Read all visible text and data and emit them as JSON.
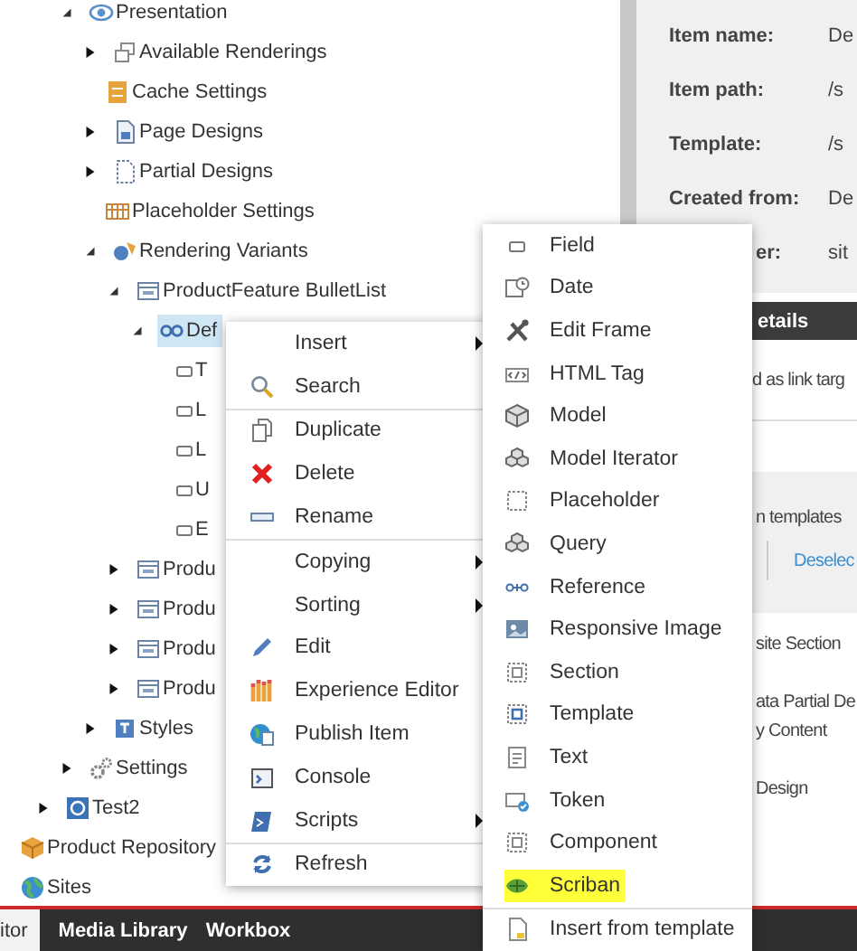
{
  "tree": {
    "items": [
      {
        "children": [
          {
            "children": [
              {
                "label": "Presentation",
                "expanded": true,
                "selected": false,
                "children": [
                  {
                    "label": "Available Renderings",
                    "expanded": false,
                    "selected": false
                  },
                  {
                    "label": "Cache Settings",
                    "selected": false
                  },
                  {
                    "label": "Page Designs",
                    "expanded": false,
                    "selected": false
                  },
                  {
                    "label": "Partial Designs",
                    "expanded": false,
                    "selected": false
                  },
                  {
                    "label": "Placeholder Settings",
                    "selected": false
                  },
                  {
                    "label": "Rendering Variants",
                    "expanded": true,
                    "selected": false,
                    "children": [
                      {
                        "label": "ProductFeature BulletList",
                        "expanded": true,
                        "selected": false,
                        "children": [
                          {
                            "label": "Def",
                            "expanded": true,
                            "selected": true,
                            "children": [
                              {
                                "label": "T",
                                "selected": false
                              },
                              {
                                "label": "L",
                                "selected": false
                              },
                              {
                                "label": "L",
                                "selected": false
                              },
                              {
                                "label": "U",
                                "selected": false
                              },
                              {
                                "label": "E",
                                "selected": false
                              }
                            ]
                          }
                        ]
                      },
                      {
                        "label": "Produ",
                        "expanded": false,
                        "selected": false
                      },
                      {
                        "label": "Produ",
                        "expanded": false,
                        "selected": false
                      },
                      {
                        "label": "Produ",
                        "expanded": false,
                        "selected": false
                      },
                      {
                        "label": "Produ",
                        "expanded": false,
                        "selected": false
                      }
                    ]
                  },
                  {
                    "label": "Styles",
                    "expanded": false,
                    "selected": false
                  }
                ]
              },
              {
                "label": "Settings",
                "expanded": false,
                "selected": false
              }
            ]
          },
          {
            "label": "Test2",
            "expanded": false,
            "selected": false
          }
        ]
      },
      {
        "label": "Product Repository",
        "selected": false
      },
      {
        "label": "Sites",
        "selected": false
      }
    ]
  },
  "details": {
    "fields": [
      {
        "label": "Item name:",
        "value": "De"
      },
      {
        "label": "Item path:",
        "value": "/s"
      },
      {
        "label": "Template:",
        "value": "/s"
      },
      {
        "label": "Created from:",
        "value": "De"
      },
      {
        "label": "er:",
        "value": "sit",
        "cut": true
      }
    ],
    "section_title": "etails",
    "link_target_text": "d as link targ",
    "templates_box": {
      "title": "n templates",
      "link": "Deselec"
    },
    "entries": [
      {
        "lines": [
          "site Section"
        ]
      },
      {
        "lines": [
          "ata Partial De",
          "y Content"
        ]
      },
      {
        "lines": [
          "Design"
        ]
      }
    ]
  },
  "context_menu": {
    "groups": [
      [
        {
          "label": "Insert",
          "submenu": true
        },
        {
          "label": "Search",
          "submenu": false
        }
      ],
      [
        {
          "label": "Duplicate",
          "submenu": false
        },
        {
          "label": "Delete",
          "submenu": false
        },
        {
          "label": "Rename",
          "submenu": false
        }
      ],
      [
        {
          "label": "Copying",
          "submenu": true
        },
        {
          "label": "Sorting",
          "submenu": true
        },
        {
          "label": "Edit",
          "submenu": false
        },
        {
          "label": "Experience Editor",
          "submenu": false
        },
        {
          "label": "Publish Item",
          "submenu": false
        },
        {
          "label": "Console",
          "submenu": false
        },
        {
          "label": "Scripts",
          "submenu": true
        }
      ],
      [
        {
          "label": "Refresh",
          "submenu": false
        }
      ]
    ]
  },
  "submenu": {
    "groups": [
      [
        {
          "label": "Field",
          "highlighted": false
        },
        {
          "label": "Date",
          "highlighted": false
        },
        {
          "label": "Edit Frame",
          "highlighted": false
        },
        {
          "label": "HTML Tag",
          "highlighted": false
        },
        {
          "label": "Model",
          "highlighted": false
        },
        {
          "label": "Model Iterator",
          "highlighted": false
        },
        {
          "label": "Placeholder",
          "highlighted": false
        },
        {
          "label": "Query",
          "highlighted": false
        },
        {
          "label": "Reference",
          "highlighted": false
        },
        {
          "label": "Responsive Image",
          "highlighted": false
        },
        {
          "label": "Section",
          "highlighted": false
        },
        {
          "label": "Template",
          "highlighted": false
        },
        {
          "label": "Text",
          "highlighted": false
        },
        {
          "label": "Token",
          "highlighted": false
        },
        {
          "label": "Component",
          "highlighted": false
        },
        {
          "label": "Scriban",
          "highlighted": true
        }
      ],
      [
        {
          "label": "Insert from template",
          "highlighted": false
        }
      ]
    ]
  },
  "bottom_tabs": [
    {
      "label": "itor",
      "selected": true
    },
    {
      "label": "Media Library",
      "selected": false
    },
    {
      "label": "Workbox",
      "selected": false
    }
  ]
}
